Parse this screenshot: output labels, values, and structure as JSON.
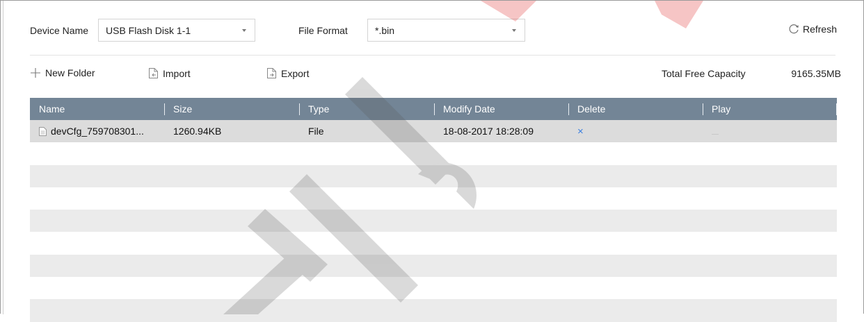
{
  "header": {
    "device_name_label": "Device Name",
    "device_name_value": "USB Flash Disk 1-1",
    "file_format_label": "File Format",
    "file_format_value": "*.bin",
    "refresh_label": "Refresh"
  },
  "toolbar": {
    "new_folder_label": "New Folder",
    "import_label": "Import",
    "export_label": "Export",
    "capacity_label": "Total Free Capacity",
    "capacity_value": "9165.35MB"
  },
  "table": {
    "columns": [
      "Name",
      "Size",
      "Type",
      "Modify Date",
      "Delete",
      "Play"
    ],
    "rows": [
      {
        "name": "devCfg_759708301...",
        "size": "1260.94KB",
        "type": "File",
        "modify_date": "18-08-2017 18:28:09",
        "delete": "×",
        "icon": "file-icon"
      }
    ]
  },
  "colors": {
    "table_header": "#738596",
    "delete_accent": "#3b7fe0",
    "row_alt": "#ebebeb"
  }
}
